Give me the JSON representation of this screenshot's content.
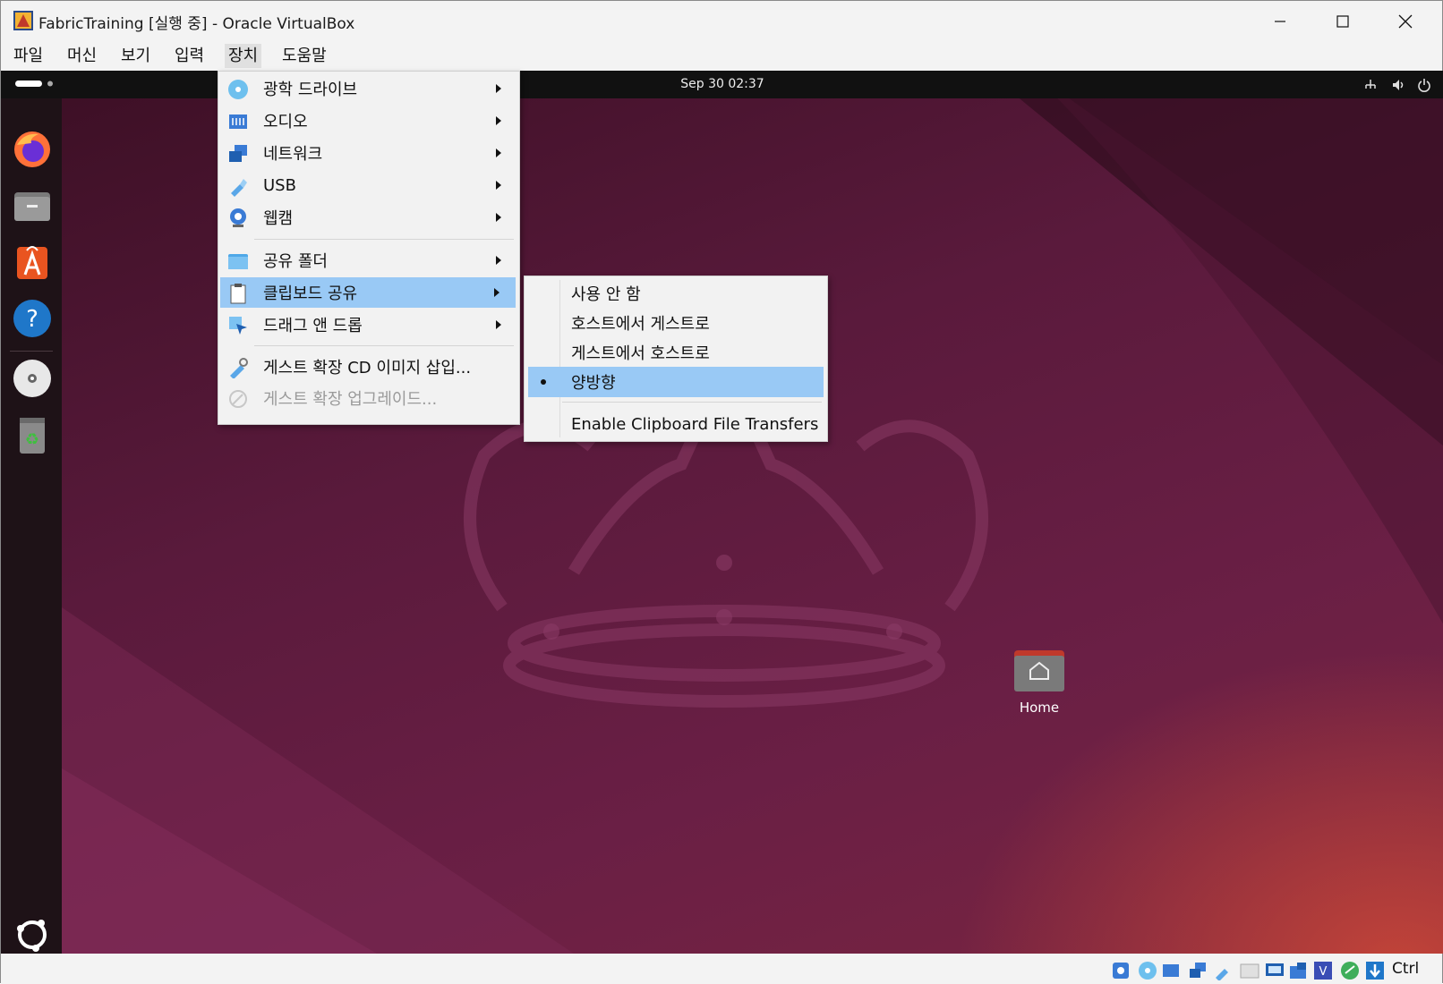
{
  "window": {
    "title": "FabricTraining [실행 중] - Oracle VirtualBox"
  },
  "menubar": {
    "items": [
      "파일",
      "머신",
      "보기",
      "입력",
      "장치",
      "도움말"
    ]
  },
  "guest": {
    "clock": "Sep 30  02:37",
    "desktop_folder": "Home"
  },
  "devices_menu": {
    "items": [
      {
        "label": "광학 드라이브",
        "icon": "optical-disc-icon",
        "submenu": true
      },
      {
        "label": "오디오",
        "icon": "audio-icon",
        "submenu": true
      },
      {
        "label": "네트워크",
        "icon": "network-icon",
        "submenu": true
      },
      {
        "label": "USB",
        "icon": "usb-icon",
        "submenu": true
      },
      {
        "label": "웹캠",
        "icon": "webcam-icon",
        "submenu": true
      },
      {
        "label": "공유 폴더",
        "icon": "shared-folder-icon",
        "submenu": true
      },
      {
        "label": "클립보드 공유",
        "icon": "clipboard-icon",
        "submenu": true,
        "highlighted": true
      },
      {
        "label": "드래그 앤 드롭",
        "icon": "drag-drop-icon",
        "submenu": true
      },
      {
        "label": "게스트 확장 CD 이미지 삽입...",
        "icon": "guest-additions-icon",
        "submenu": false
      },
      {
        "label": "게스트 확장 업그레이드...",
        "icon": "guest-additions-upgrade-icon",
        "submenu": false,
        "disabled": true
      }
    ]
  },
  "clipboard_submenu": {
    "items": [
      {
        "label": "사용 안 함",
        "checked": false
      },
      {
        "label": "호스트에서 게스트로",
        "checked": false
      },
      {
        "label": "게스트에서 호스트로",
        "checked": false
      },
      {
        "label": "양방향",
        "checked": true,
        "highlighted": true
      },
      {
        "label": "Enable Clipboard File Transfers",
        "checked": false
      }
    ]
  },
  "statusbar": {
    "host_key": "Ctrl"
  },
  "colors": {
    "highlight": "#99c9f5",
    "menu_bg": "#f2f2f2",
    "desktop": "#5a1a3c",
    "accent_orange": "#e95420"
  }
}
